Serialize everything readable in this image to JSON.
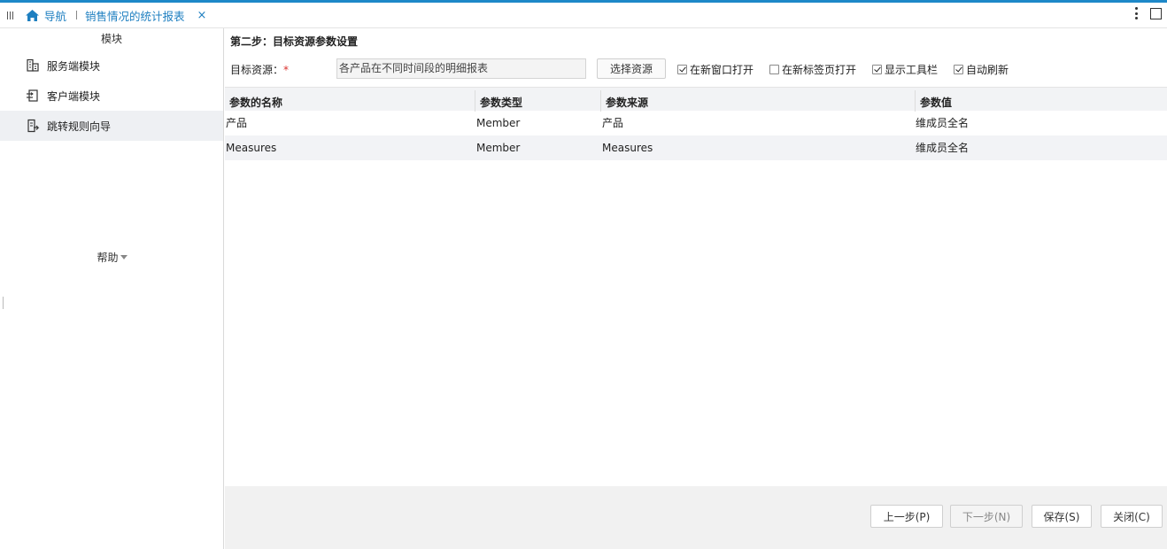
{
  "tabbar": {
    "nav_label": "导航",
    "active_tab": "销售情况的统计报表",
    "close_glyph": "×"
  },
  "sidebar": {
    "header": "模块",
    "items": [
      {
        "label": "服务端模块",
        "icon": "server-module-icon"
      },
      {
        "label": "客户端模块",
        "icon": "client-module-icon"
      },
      {
        "label": "跳转规则向导",
        "icon": "jump-rule-wizard-icon"
      }
    ],
    "help_label": "帮助"
  },
  "main": {
    "step_title": "第二步：目标资源参数设置",
    "target_label": "目标资源：",
    "required_mark": "*",
    "target_value": "各产品在不同时间段的明细报表",
    "select_button": "选择资源",
    "options": [
      {
        "label": "在新窗口打开",
        "checked": true
      },
      {
        "label": "在新标签页打开",
        "checked": false
      },
      {
        "label": "显示工具栏",
        "checked": true
      },
      {
        "label": "自动刷新",
        "checked": true
      }
    ]
  },
  "table": {
    "headers": [
      "参数的名称",
      "参数类型",
      "参数来源",
      "参数值"
    ],
    "rows": [
      [
        "产品",
        "Member",
        "产品",
        "维成员全名"
      ],
      [
        "Measures",
        "Member",
        "Measures",
        "维成员全名"
      ]
    ]
  },
  "footer": {
    "prev": "上一步(P)",
    "next": "下一步(N)",
    "save": "保存(S)",
    "close": "关闭(C)"
  },
  "colors": {
    "accent": "#1e88c8",
    "link": "#1e7fc0",
    "required": "#d9302c"
  }
}
